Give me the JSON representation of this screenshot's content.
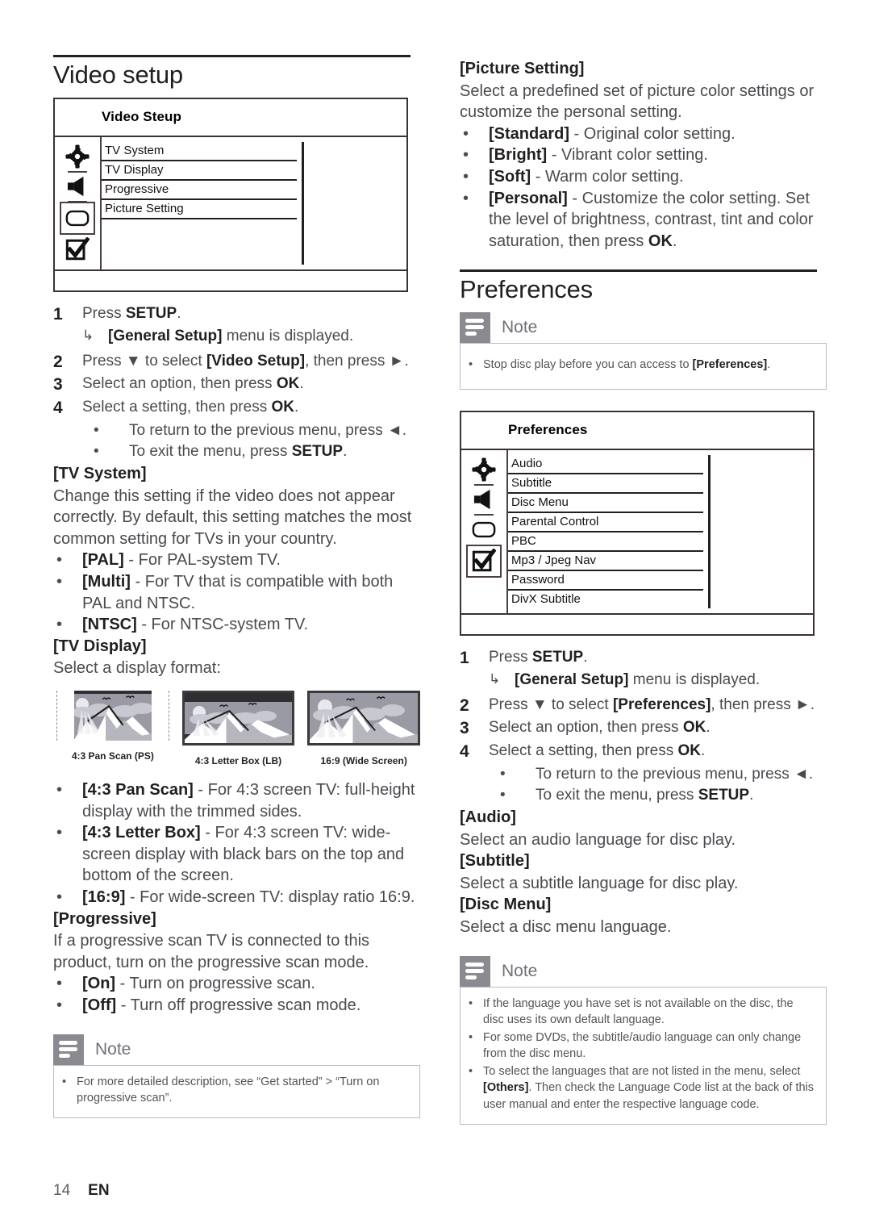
{
  "left": {
    "section_title": "Video setup",
    "osd": {
      "title": "Video Steup",
      "icons": [
        "gear-icon",
        "speaker-icon",
        "tv-screen-icon",
        "checkbox-icon"
      ],
      "selected_icon_index": 2,
      "items": [
        "TV System",
        "TV Display",
        "Progressive",
        "Picture Setting"
      ]
    },
    "steps": [
      {
        "num": "1",
        "text_html": "Press <b>SETUP</b>."
      },
      {
        "num": "2",
        "text_html": "Press ▼ to select <b>[Video Setup]</b>, then press ▶."
      },
      {
        "num": "3",
        "text_html": "Select an option, then press <b>OK</b>."
      },
      {
        "num": "4",
        "text_html": "Select a setting, then press <b>OK</b>."
      }
    ],
    "step1_result": "[General Setup] menu is displayed.",
    "step1_result_bold": "[General Setup]",
    "step1_result_rest": " menu is displayed.",
    "step4_bullets": [
      "To return to the previous menu, press ◀.",
      "To exit the menu, press SETUP."
    ],
    "tv_system": {
      "heading": "[TV System]",
      "para": "Change this setting if the video does not appear correctly. By default, this setting matches the most common setting for TVs in your country.",
      "options": [
        {
          "label": "[PAL]",
          "desc": " - For PAL-system TV."
        },
        {
          "label": "[Multi]",
          "desc": " - For TV that is compatible with both PAL and NTSC."
        },
        {
          "label": "[NTSC]",
          "desc": " - For NTSC-system TV."
        }
      ]
    },
    "tv_display": {
      "heading": "[TV Display]",
      "para": "Select a display format:",
      "figures": [
        {
          "caption": "4:3 Pan Scan (PS)"
        },
        {
          "caption": "4:3 Letter Box (LB)"
        },
        {
          "caption": "16:9 (Wide Screen)"
        }
      ],
      "options": [
        {
          "label": "[4:3 Pan Scan]",
          "desc": " - For 4:3 screen TV: full-height display with the trimmed sides."
        },
        {
          "label": "[4:3 Letter Box]",
          "desc": " - For 4:3 screen TV: wide-screen display with black bars on the top and bottom of the screen."
        },
        {
          "label": "[16:9]",
          "desc": " - For wide-screen TV: display ratio 16:9."
        }
      ]
    },
    "progressive": {
      "heading": "[Progressive]",
      "para": "If a progressive scan TV is connected to this product, turn on the progressive scan mode.",
      "options": [
        {
          "label": "[On]",
          "desc": " - Turn on progressive scan."
        },
        {
          "label": "[Off]",
          "desc": " - Turn off progressive scan mode."
        }
      ]
    },
    "note": {
      "label": "Note",
      "items": [
        "For more detailed description, see “Get started” > “Turn on progressive scan”."
      ]
    }
  },
  "right": {
    "picture_setting": {
      "heading": "[Picture Setting]",
      "para": "Select a predefined set of picture color settings or customize the personal setting.",
      "options": [
        {
          "label": "[Standard]",
          "desc": " - Original color setting."
        },
        {
          "label": "[Bright]",
          "desc": " - Vibrant color setting."
        },
        {
          "label": "[Soft]",
          "desc": " - Warm color setting."
        },
        {
          "label": "[Personal]",
          "desc_html": " - Customize the color setting. Set the level of brightness, contrast, tint and color saturation, then press <b>OK</b>."
        }
      ]
    },
    "section_title": "Preferences",
    "note_top": {
      "label": "Note",
      "items_html": [
        "Stop disc play before you can access to <b>[Preferences]</b>."
      ]
    },
    "osd": {
      "title": "Preferences",
      "icons": [
        "gear-icon",
        "speaker-icon",
        "tv-screen-icon",
        "checkbox-icon"
      ],
      "selected_icon_index": 3,
      "items": [
        "Audio",
        "Subtitle",
        "Disc Menu",
        "Parental Control",
        "PBC",
        "Mp3 / Jpeg Nav",
        "Password",
        "DivX Subtitle"
      ]
    },
    "steps": [
      {
        "num": "1",
        "text_html": "Press <b>SETUP</b>."
      },
      {
        "num": "2",
        "text_html": "Press ▼ to select <b>[Preferences]</b>, then press ▶."
      },
      {
        "num": "3",
        "text_html": "Select an option, then press <b>OK</b>."
      },
      {
        "num": "4",
        "text_html": "Select a setting, then press <b>OK</b>."
      }
    ],
    "step1_result_bold": "[General Setup]",
    "step1_result_rest": " menu is displayed.",
    "step4_bullets": [
      "To return to the previous menu, press ◀.",
      "To exit the menu, press SETUP."
    ],
    "subsections": [
      {
        "heading": "[Audio]",
        "para": "Select an audio language for disc play."
      },
      {
        "heading": "[Subtitle]",
        "para": "Select a subtitle language for disc play."
      },
      {
        "heading": "[Disc Menu]",
        "para": "Select a disc menu language."
      }
    ],
    "note_bottom": {
      "label": "Note",
      "items_html": [
        "If the language you have set is not available on the disc, the disc uses its own default language.",
        "For some DVDs, the subtitle/audio language can only change from the disc menu.",
        "To select the languages that are not listed in the menu, select <b>[Others]</b>. Then check the Language Code list at the back of this user manual and enter the respective language code."
      ]
    }
  },
  "footer": {
    "page_number": "14",
    "language": "EN"
  },
  "colors": {
    "ink": "#231f20",
    "body": "#4a4a50",
    "note_gray": "#8a8a90",
    "note_border": "#b9bcc6"
  }
}
